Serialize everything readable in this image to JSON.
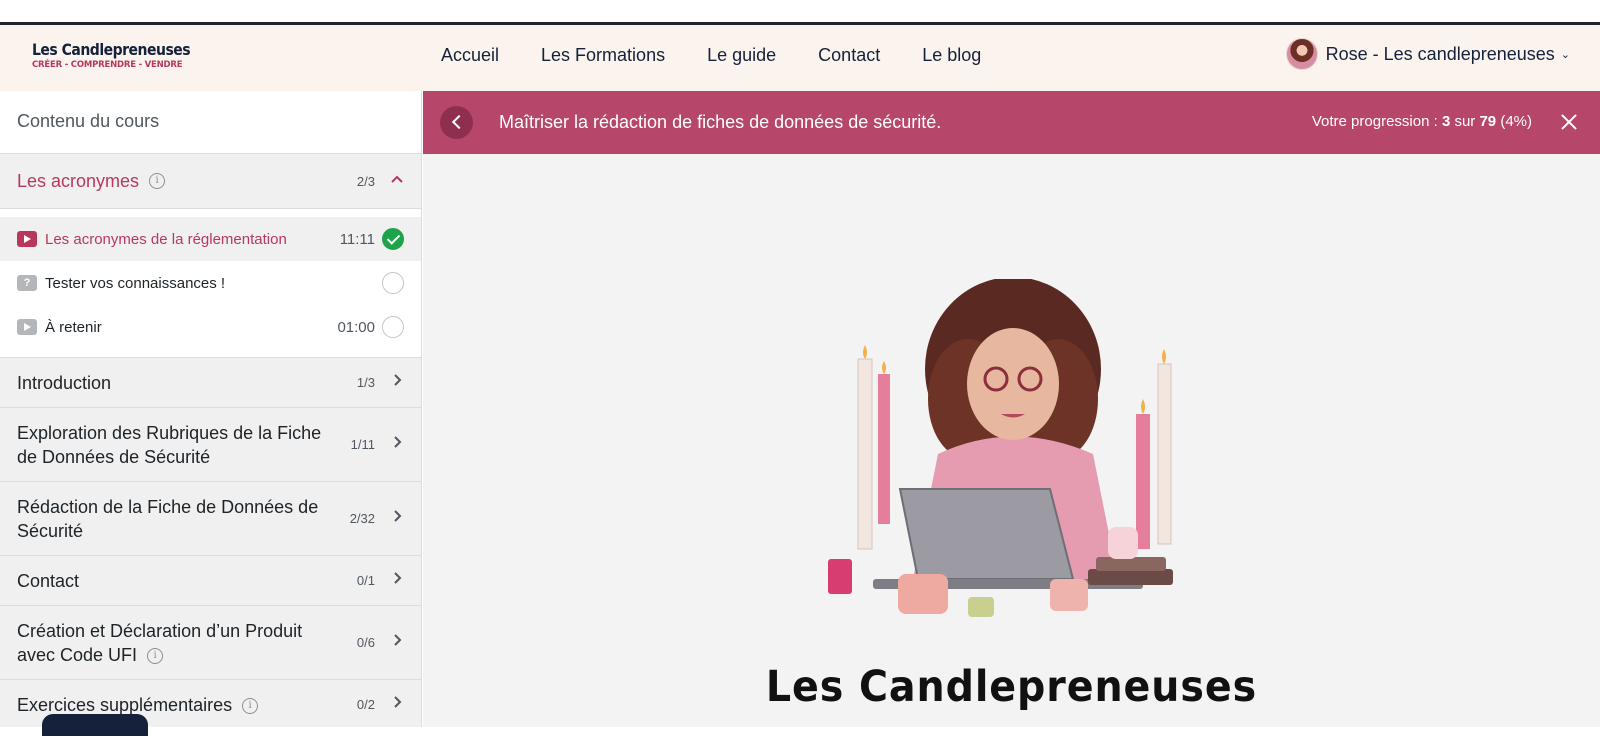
{
  "header": {
    "logo_title": "Les Candlepreneuses",
    "logo_subtitle": "CRÉER - COMPRENDRE - VENDRE",
    "nav": [
      "Accueil",
      "Les Formations",
      "Le guide",
      "Contact",
      "Le blog"
    ],
    "user_name": "Rose - Les candlepreneuses",
    "user_caret": "⌄"
  },
  "sidebar": {
    "heading": "Contenu du cours",
    "open_section": {
      "title": "Les acronymes",
      "count": "2/3",
      "lessons": [
        {
          "title": "Les acronymes de la réglementation",
          "duration": "11:11",
          "type": "video",
          "completed": true,
          "current": true
        },
        {
          "title": "Tester vos connaissances !",
          "duration": "",
          "type": "quiz",
          "completed": false,
          "current": false
        },
        {
          "title": "À retenir",
          "duration": "01:00",
          "type": "video",
          "completed": false,
          "current": false
        }
      ]
    },
    "sections": [
      {
        "title": "Introduction",
        "count": "1/3"
      },
      {
        "title": "Exploration des Rubriques de la Fiche de Données de Sécurité",
        "count": "1/11"
      },
      {
        "title": "Rédaction de la Fiche de Données de Sécurité",
        "count": "2/32"
      },
      {
        "title": "Contact",
        "count": "0/1"
      },
      {
        "title": "Création et Déclaration d’un Produit avec Code UFI",
        "count": "0/6"
      },
      {
        "title": "Exercices supplémentaires",
        "count": "0/2"
      }
    ],
    "info_glyph": "i"
  },
  "course_bar": {
    "title": "Maîtriser la rédaction de fiches de données de sécurité.",
    "progress_prefix": "Votre progression :",
    "progress_done": "3",
    "progress_sep": "sur",
    "progress_total": "79",
    "progress_percent": "(4%)"
  },
  "content": {
    "brand_text": "Les Candlepreneuses"
  },
  "colors": {
    "accent": "#b7476a",
    "accent_dark": "#8f2f4f",
    "success": "#1ea34a",
    "navy": "#15213a"
  }
}
